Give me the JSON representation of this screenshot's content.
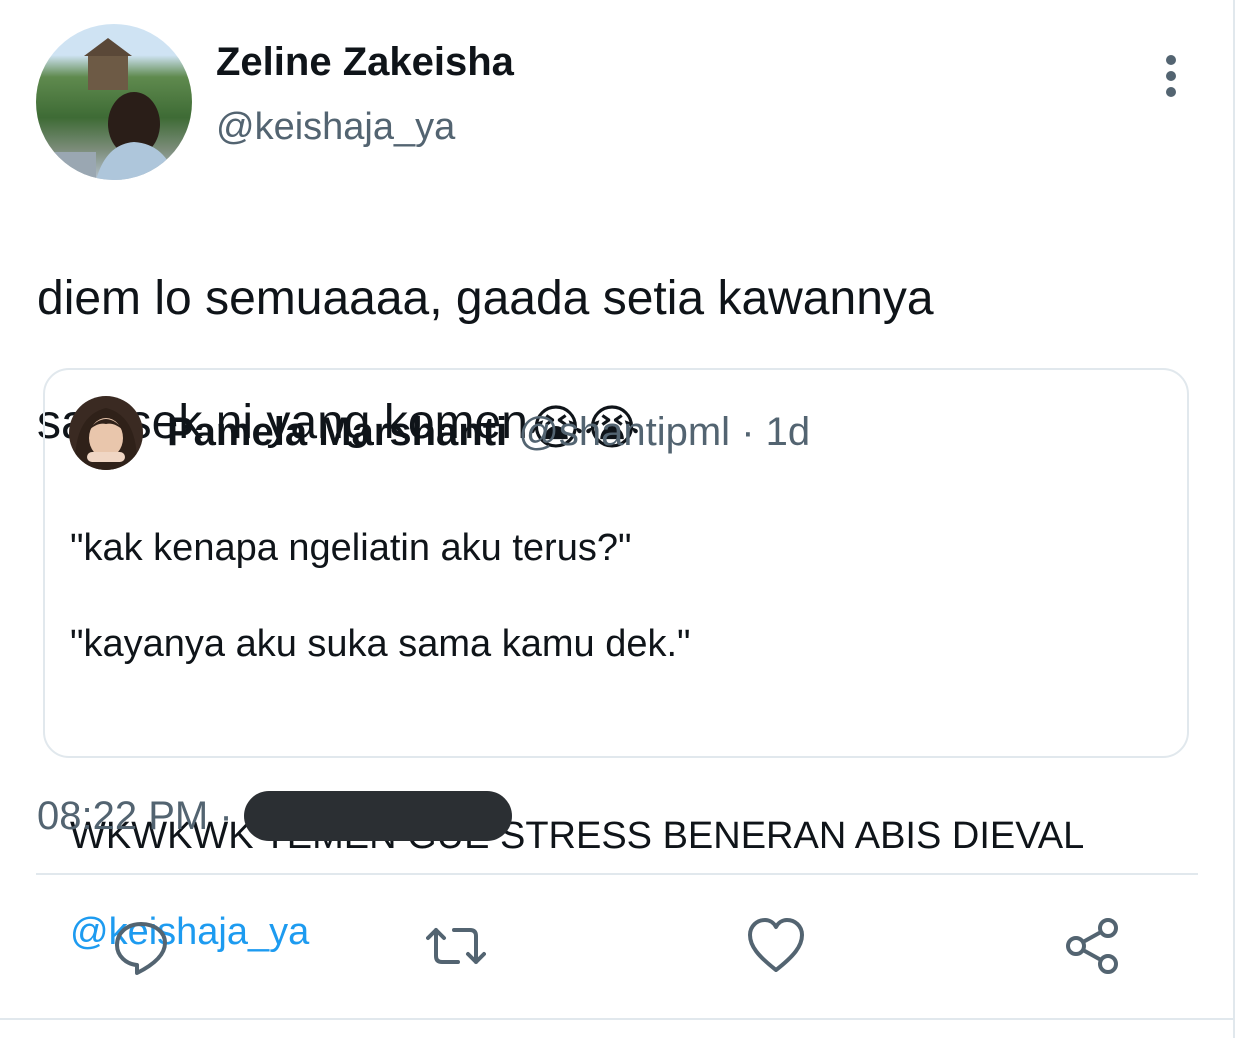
{
  "author": {
    "display_name": "Zeline Zakeisha",
    "handle": "@keishaja_ya"
  },
  "tweet": {
    "text_line1": "diem lo semuaaaa, gaada setia kawannya",
    "text_line2": "samsek ni yang komen",
    "emojis": [
      "😭",
      "😭"
    ]
  },
  "quoted_tweet": {
    "display_name": "Pamela Marshanti",
    "handle": "@shantipml",
    "separator": "·",
    "age": "1d",
    "body_line1": "\"kak kenapa ngeliatin aku terus?\"",
    "body_line2": "\"kayanya aku suka sama kamu dek.\"",
    "body_line3": "WKWKWK TEMEN GUE STRESS BENERAN ABIS DIEVAL",
    "mention": "@keishaja_ya"
  },
  "meta": {
    "time": "08:22 PM",
    "separator": "·"
  },
  "actions": {
    "icons": [
      "reply-icon",
      "retweet-icon",
      "like-icon",
      "share-icon"
    ]
  },
  "colors": {
    "text": "#0f1419",
    "secondary": "#536471",
    "accent": "#1d9bf0",
    "border": "#e1e8ed",
    "redaction": "#2b2f33"
  }
}
